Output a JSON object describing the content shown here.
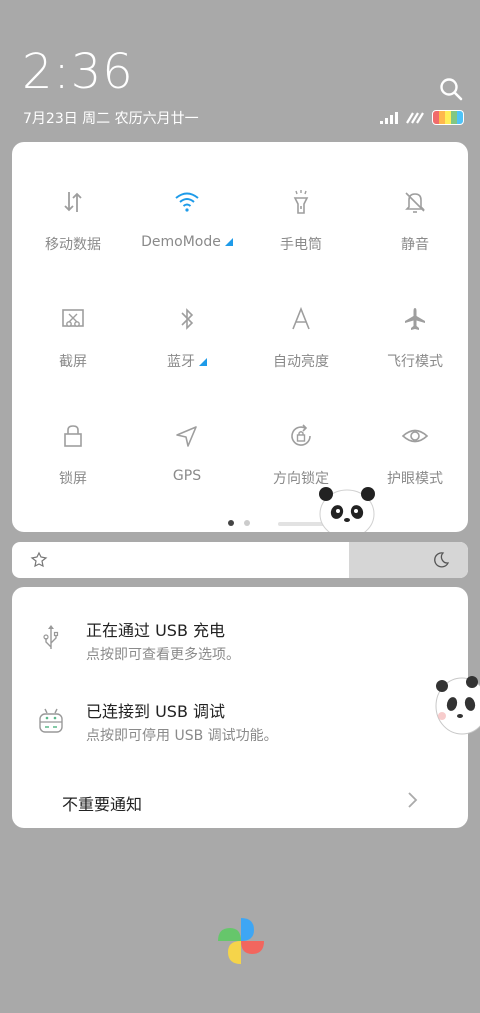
{
  "status": {
    "time": "2:36",
    "date": "7月23日  周二  农历六月廿一"
  },
  "quick_settings": {
    "tiles": [
      {
        "label": "移动数据",
        "icon": "mobile-data-icon",
        "active": false
      },
      {
        "label": "DemoMode",
        "icon": "wifi-icon",
        "active": true
      },
      {
        "label": "手电筒",
        "icon": "flashlight-icon",
        "active": false
      },
      {
        "label": "静音",
        "icon": "mute-icon",
        "active": false
      },
      {
        "label": "截屏",
        "icon": "screenshot-icon",
        "active": false
      },
      {
        "label": "蓝牙",
        "icon": "bluetooth-icon",
        "active": false
      },
      {
        "label": "自动亮度",
        "icon": "auto-brightness-icon",
        "active": false
      },
      {
        "label": "飞行模式",
        "icon": "airplane-icon",
        "active": false
      },
      {
        "label": "锁屏",
        "icon": "lock-icon",
        "active": false
      },
      {
        "label": "GPS",
        "icon": "gps-icon",
        "active": false
      },
      {
        "label": "方向锁定",
        "icon": "rotation-lock-icon",
        "active": false
      },
      {
        "label": "护眼模式",
        "icon": "eye-icon",
        "active": false
      }
    ],
    "accent_color": "#1e9be9"
  },
  "brightness": {
    "level_fraction": 0.74
  },
  "notifications": [
    {
      "title": "正在通过 USB 充电",
      "subtitle": "点按即可查看更多选项。",
      "icon": "usb-icon"
    },
    {
      "title": "已连接到 USB 调试",
      "subtitle": "点按即可停用 USB 调试功能。",
      "icon": "android-icon"
    }
  ],
  "unimportant_label": "不重要通知"
}
